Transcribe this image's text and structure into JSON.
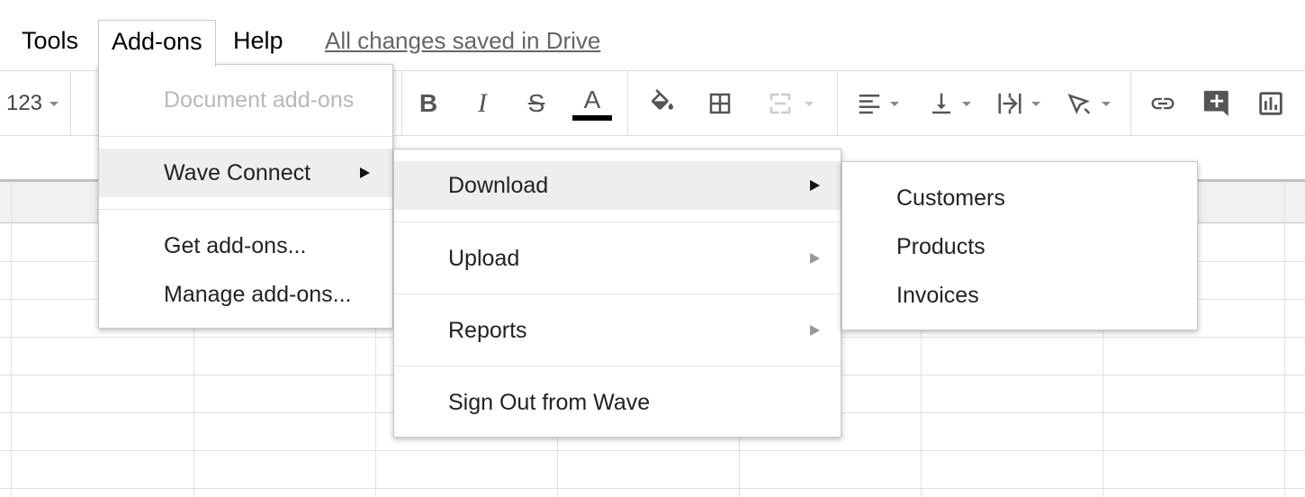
{
  "menubar": {
    "tools_label": "Tools",
    "addons_label": "Add-ons",
    "help_label": "Help",
    "save_status": "All changes saved in Drive"
  },
  "toolbar": {
    "number_format": "123",
    "icons": [
      "bold-icon",
      "italic-icon",
      "strikethrough-icon",
      "text-color-icon",
      "fill-color-icon",
      "borders-icon",
      "merge-cells-icon",
      "align-horizontal-icon",
      "align-vertical-icon",
      "text-wrap-icon",
      "text-rotate-icon",
      "insert-link-icon",
      "insert-comment-icon",
      "insert-chart-icon"
    ],
    "bold": "B",
    "italic": "I",
    "strike": "S",
    "text_color": "A"
  },
  "addons_menu": {
    "header": "Document add-ons",
    "items": [
      {
        "label": "Wave Connect",
        "has_submenu": true,
        "highlighted": true
      },
      {
        "label": "Get add-ons..."
      },
      {
        "label": "Manage add-ons..."
      }
    ]
  },
  "wave_menu": {
    "items": [
      {
        "label": "Download",
        "has_submenu": true,
        "highlighted": true
      },
      {
        "label": "Upload",
        "has_submenu": true
      },
      {
        "label": "Reports",
        "has_submenu": true
      },
      {
        "label": "Sign Out from Wave"
      }
    ]
  },
  "download_menu": {
    "items": [
      {
        "label": "Customers"
      },
      {
        "label": "Products"
      },
      {
        "label": "Invoices"
      }
    ]
  },
  "colors": {
    "highlight": "#eeeeee",
    "disabled_text": "#b8b8b8",
    "text_color_bar": "#000000"
  }
}
